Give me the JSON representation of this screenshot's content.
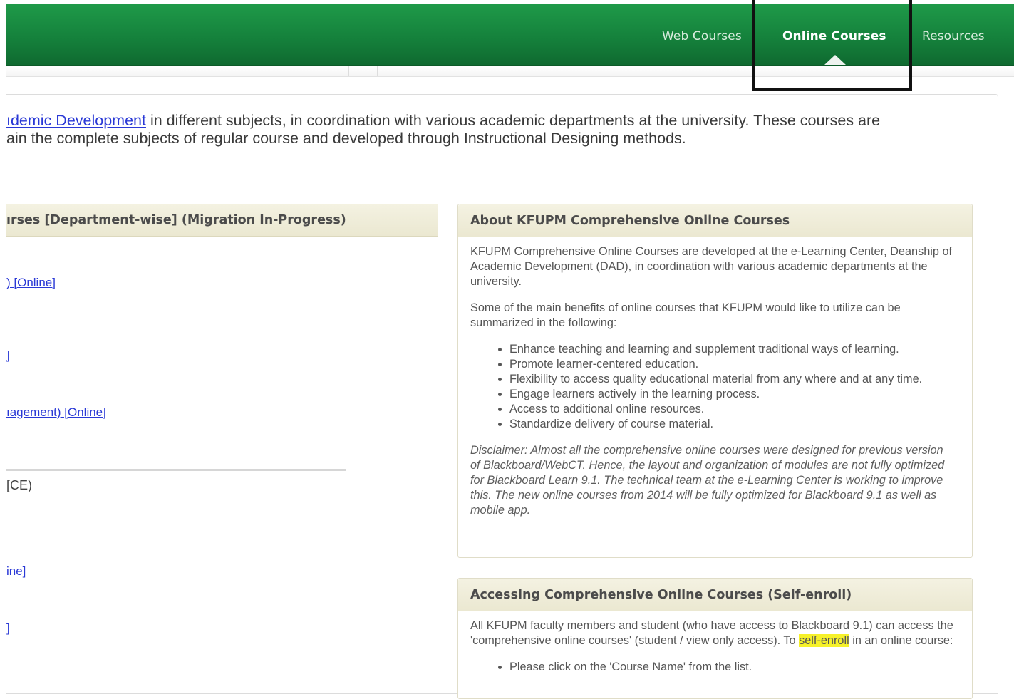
{
  "nav": {
    "items": [
      {
        "label": "Web Courses",
        "active": false
      },
      {
        "label": "Online Courses",
        "active": true
      },
      {
        "label": "Resources",
        "active": false
      }
    ],
    "accent_color": "#17883f"
  },
  "intro": {
    "link_text": "ıdemic Development",
    "line1_rest": " in different subjects, in coordination with various academic departments at the university. These courses are",
    "line2": "ain the complete subjects of regular course and developed through Instructional Designing methods."
  },
  "left_panel": {
    "header": "ırses [Department-wise] (Migration In-Progress)",
    "links": [
      {
        "text": ") [Online]"
      },
      {
        "text": "]"
      },
      {
        "text": "ıagement) [Online]"
      },
      {
        "text": "ine]"
      },
      {
        "text": "]"
      }
    ],
    "section_text": "[CE)"
  },
  "about_panel": {
    "header": "About KFUPM Comprehensive Online Courses",
    "para1": "KFUPM Comprehensive Online Courses are developed at the e-Learning Center, Deanship of Academic Development (DAD), in coordination with various academic departments at the university.",
    "para2": "Some of the main benefits of online courses that KFUPM would like to utilize can be summarized in the following:",
    "bullets": [
      "Enhance teaching and learning and supplement traditional ways of learning.",
      "Promote learner-centered education.",
      "Flexibility to access quality educational material from any where and at any time.",
      "Engage learners actively in the learning process.",
      "Access to additional online resources.",
      "Standardize delivery of course material."
    ],
    "disclaimer": "Disclaimer: Almost all the comprehensive online courses were designed for previous version of Blackboard/WebCT. Hence, the layout and organization of modules are not fully optimized for Blackboard Learn 9.1. The technical team at the e-Learning Center is working to improve this. The new online courses from 2014 will be fully optimized for Blackboard 9.1 as well as mobile app."
  },
  "access_panel": {
    "header": "Accessing Comprehensive Online Courses (Self-enroll)",
    "para_before": "All KFUPM faculty members and student (who have access to Blackboard 9.1) can access the 'comprehensive online courses' (student / view only access). To ",
    "highlight": "self-enroll",
    "para_after": " in an online course:",
    "bullets": [
      "Please click on the 'Course Name' from the list."
    ],
    "highlight_color": "#f6f12a"
  }
}
